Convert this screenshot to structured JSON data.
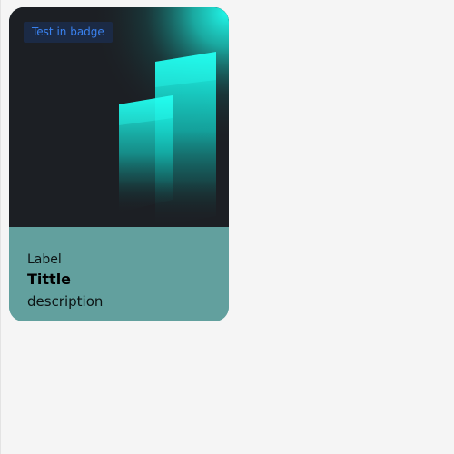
{
  "card": {
    "badge": "Test in badge",
    "label": "Label",
    "title": "Tittle",
    "description": "description"
  },
  "colors": {
    "page_background": "#f5f5f5",
    "media_background": "#1c1f24",
    "accent_cyan": "#21f7e9",
    "card_body": "#62a09e",
    "badge_text": "#3a82f0",
    "badge_background": "#1b2a45"
  },
  "illustration": {
    "name": "teal-bars-illustration"
  }
}
